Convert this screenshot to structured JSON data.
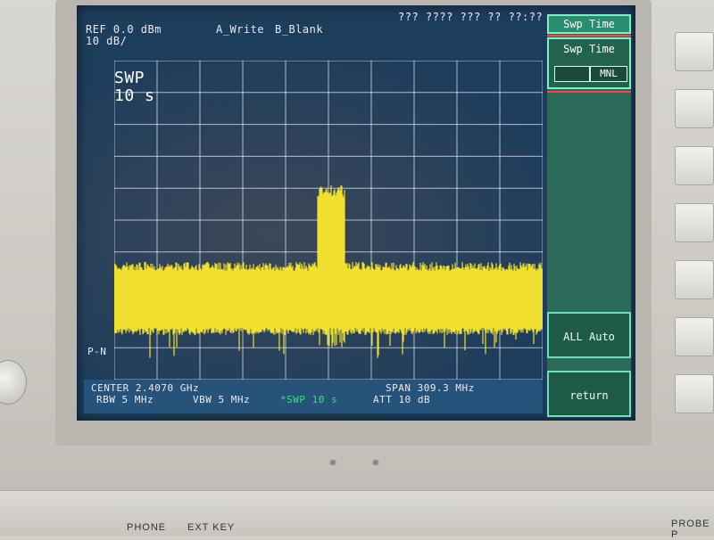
{
  "screen": {
    "ref_level": "REF 0.0 dBm",
    "scale": "10 dB/",
    "trace_a": "A_Write",
    "trace_b": "B_Blank",
    "datetime": "??? ???? ??? ?? ??:??",
    "sweep_label": "SWP",
    "sweep_value": "10 s",
    "detector": "P-N",
    "center": "CENTER 2.4070 GHz",
    "span": "SPAN 309.3 MHz",
    "rbw": "RBW 5 MHz",
    "vbw": "VBW 5 MHz",
    "swp": "*SWP 10 s",
    "att": "ATT 10 dB"
  },
  "softkeys": {
    "header": "Swp Time",
    "swp_time_label": "Swp Time",
    "swp_time_mode": "MNL",
    "all_auto": "ALL Auto",
    "return": "return"
  },
  "panel": {
    "phone": "PHONE",
    "ext_key": "EXT KEY",
    "probe": "PROBE P"
  },
  "colors": {
    "trace": "#f0e030",
    "grid": "#d8dcf0",
    "screen_bg": "#1d3d5c",
    "softkey_green": "#2b6a58",
    "active_text": "#35e07a"
  }
}
